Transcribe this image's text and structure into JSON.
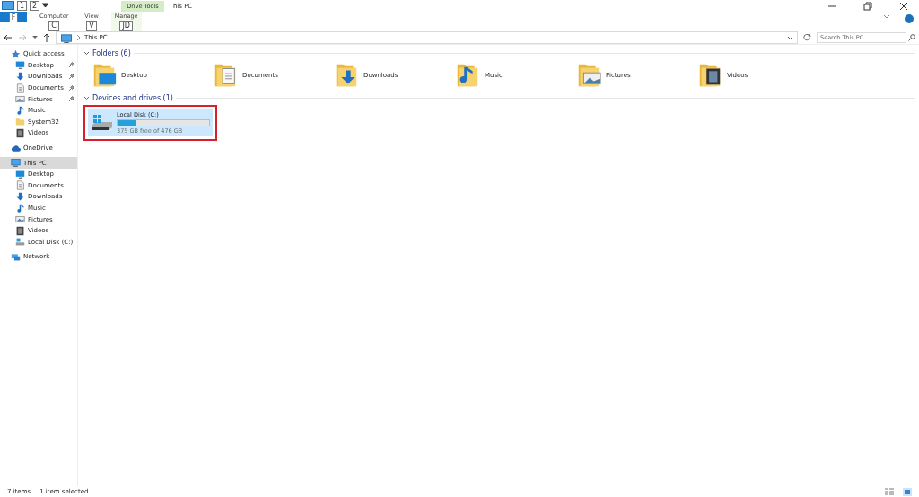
{
  "title_bar": {
    "context_tab": "Drive Tools",
    "title": "This PC",
    "key_tips": [
      "1",
      "2"
    ]
  },
  "ribbon_tabs": [
    {
      "label": "F",
      "kind": "file",
      "selected": false
    },
    {
      "label": "Computer",
      "kind": "tab",
      "key_tip": "C",
      "selected": false
    },
    {
      "label": "View",
      "kind": "tab",
      "key_tip": "V",
      "selected": false
    },
    {
      "label": "Manage",
      "kind": "context",
      "key_tip": "JD",
      "selected": false
    }
  ],
  "address_bar": {
    "path": "This PC",
    "search_placeholder": "Search This PC"
  },
  "navigation_pane": [
    {
      "label": "Quick access",
      "kind": "star",
      "selected": false,
      "children": [
        {
          "label": "Desktop",
          "kind": "desktop",
          "pinned": true,
          "selected": false
        },
        {
          "label": "Downloads",
          "kind": "downloads",
          "pinned": true,
          "selected": false
        },
        {
          "label": "Documents",
          "kind": "documents",
          "pinned": true,
          "selected": false
        },
        {
          "label": "Pictures",
          "kind": "pictures",
          "pinned": true,
          "selected": false
        },
        {
          "label": "Music",
          "kind": "music",
          "pinned": false,
          "selected": false
        },
        {
          "label": "System32",
          "kind": "folder",
          "pinned": false,
          "selected": false
        },
        {
          "label": "Videos",
          "kind": "videos",
          "pinned": false,
          "selected": false
        }
      ]
    },
    {
      "label": "OneDrive",
      "kind": "cloud",
      "selected": false
    },
    {
      "label": "This PC",
      "kind": "pc",
      "selected": true,
      "children": [
        {
          "label": "Desktop",
          "kind": "desktop",
          "pinned": false,
          "selected": false
        },
        {
          "label": "Documents",
          "kind": "documents",
          "pinned": false,
          "selected": false
        },
        {
          "label": "Downloads",
          "kind": "downloads",
          "pinned": false,
          "selected": false
        },
        {
          "label": "Music",
          "kind": "music",
          "pinned": false,
          "selected": false
        },
        {
          "label": "Pictures",
          "kind": "pictures",
          "pinned": false,
          "selected": false
        },
        {
          "label": "Videos",
          "kind": "videos",
          "pinned": false,
          "selected": false
        },
        {
          "label": "Local Disk (C:)",
          "kind": "drive",
          "pinned": false,
          "selected": false
        }
      ]
    },
    {
      "label": "Network",
      "kind": "network",
      "selected": false
    }
  ],
  "folders": {
    "heading": "Folders (6)",
    "items": [
      {
        "label": "Desktop",
        "kind": "desktop"
      },
      {
        "label": "Documents",
        "kind": "documents"
      },
      {
        "label": "Downloads",
        "kind": "downloads"
      },
      {
        "label": "Music",
        "kind": "music"
      },
      {
        "label": "Pictures",
        "kind": "pictures"
      },
      {
        "label": "Videos",
        "kind": "videos"
      }
    ]
  },
  "drives": {
    "heading": "Devices and drives (1)",
    "items": [
      {
        "name": "Local Disk (C:)",
        "free": "375 GB free of 476 GB",
        "level": 0.21,
        "selected": true,
        "highlighted": true
      }
    ]
  },
  "status_bar": {
    "count": "7 items",
    "selection": "1 item selected"
  }
}
